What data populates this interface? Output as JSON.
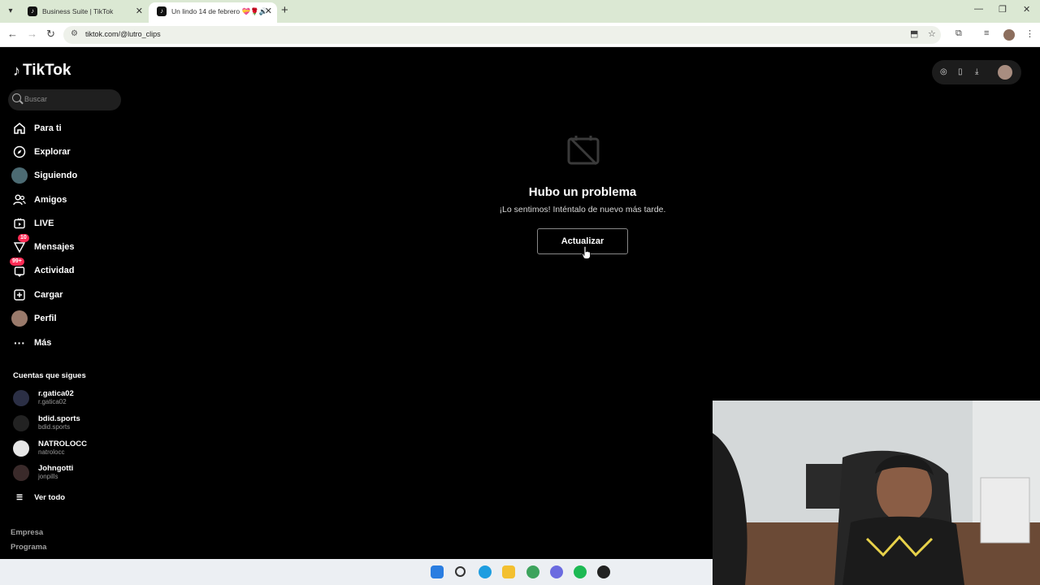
{
  "browser": {
    "tabs": [
      {
        "title": "Business Suite | TikTok"
      },
      {
        "title": "Un lindo 14 de febrero 💝🌹🔊"
      }
    ],
    "url": "tiktok.com/@lutro_clips"
  },
  "sidebar": {
    "logo_text": "TikTok",
    "search_placeholder": "Buscar",
    "nav": [
      {
        "label": "Para ti",
        "icon": "home-icon"
      },
      {
        "label": "Explorar",
        "icon": "compass-icon"
      },
      {
        "label": "Siguiendo",
        "icon": "avatar"
      },
      {
        "label": "Amigos",
        "icon": "friends-icon"
      },
      {
        "label": "LIVE",
        "icon": "live-icon"
      },
      {
        "label": "Mensajes",
        "icon": "inbox-icon",
        "badge": "10"
      },
      {
        "label": "Actividad",
        "icon": "activity-icon",
        "badge": "99+"
      },
      {
        "label": "Cargar",
        "icon": "upload-icon"
      },
      {
        "label": "Perfil",
        "icon": "avatar"
      },
      {
        "label": "Más",
        "icon": "more-icon"
      }
    ],
    "following_title": "Cuentas que sigues",
    "following": [
      {
        "name": "r.gatica02",
        "handle": "r.gatica02"
      },
      {
        "name": "bdid.sports",
        "handle": "bdid.sports"
      },
      {
        "name": "NATROLOCC",
        "handle": "natrolocc"
      },
      {
        "name": "Johngotti",
        "handle": "jonpills"
      }
    ],
    "see_all": "Ver todo",
    "footer": [
      "Empresa",
      "Programa"
    ]
  },
  "main": {
    "error_title": "Hubo un problema",
    "error_subtitle": "¡Lo sentimos! Inténtalo de nuevo más tarde.",
    "retry_label": "Actualizar"
  },
  "colors": {
    "background": "#000000",
    "badge": "#fe2c55"
  }
}
